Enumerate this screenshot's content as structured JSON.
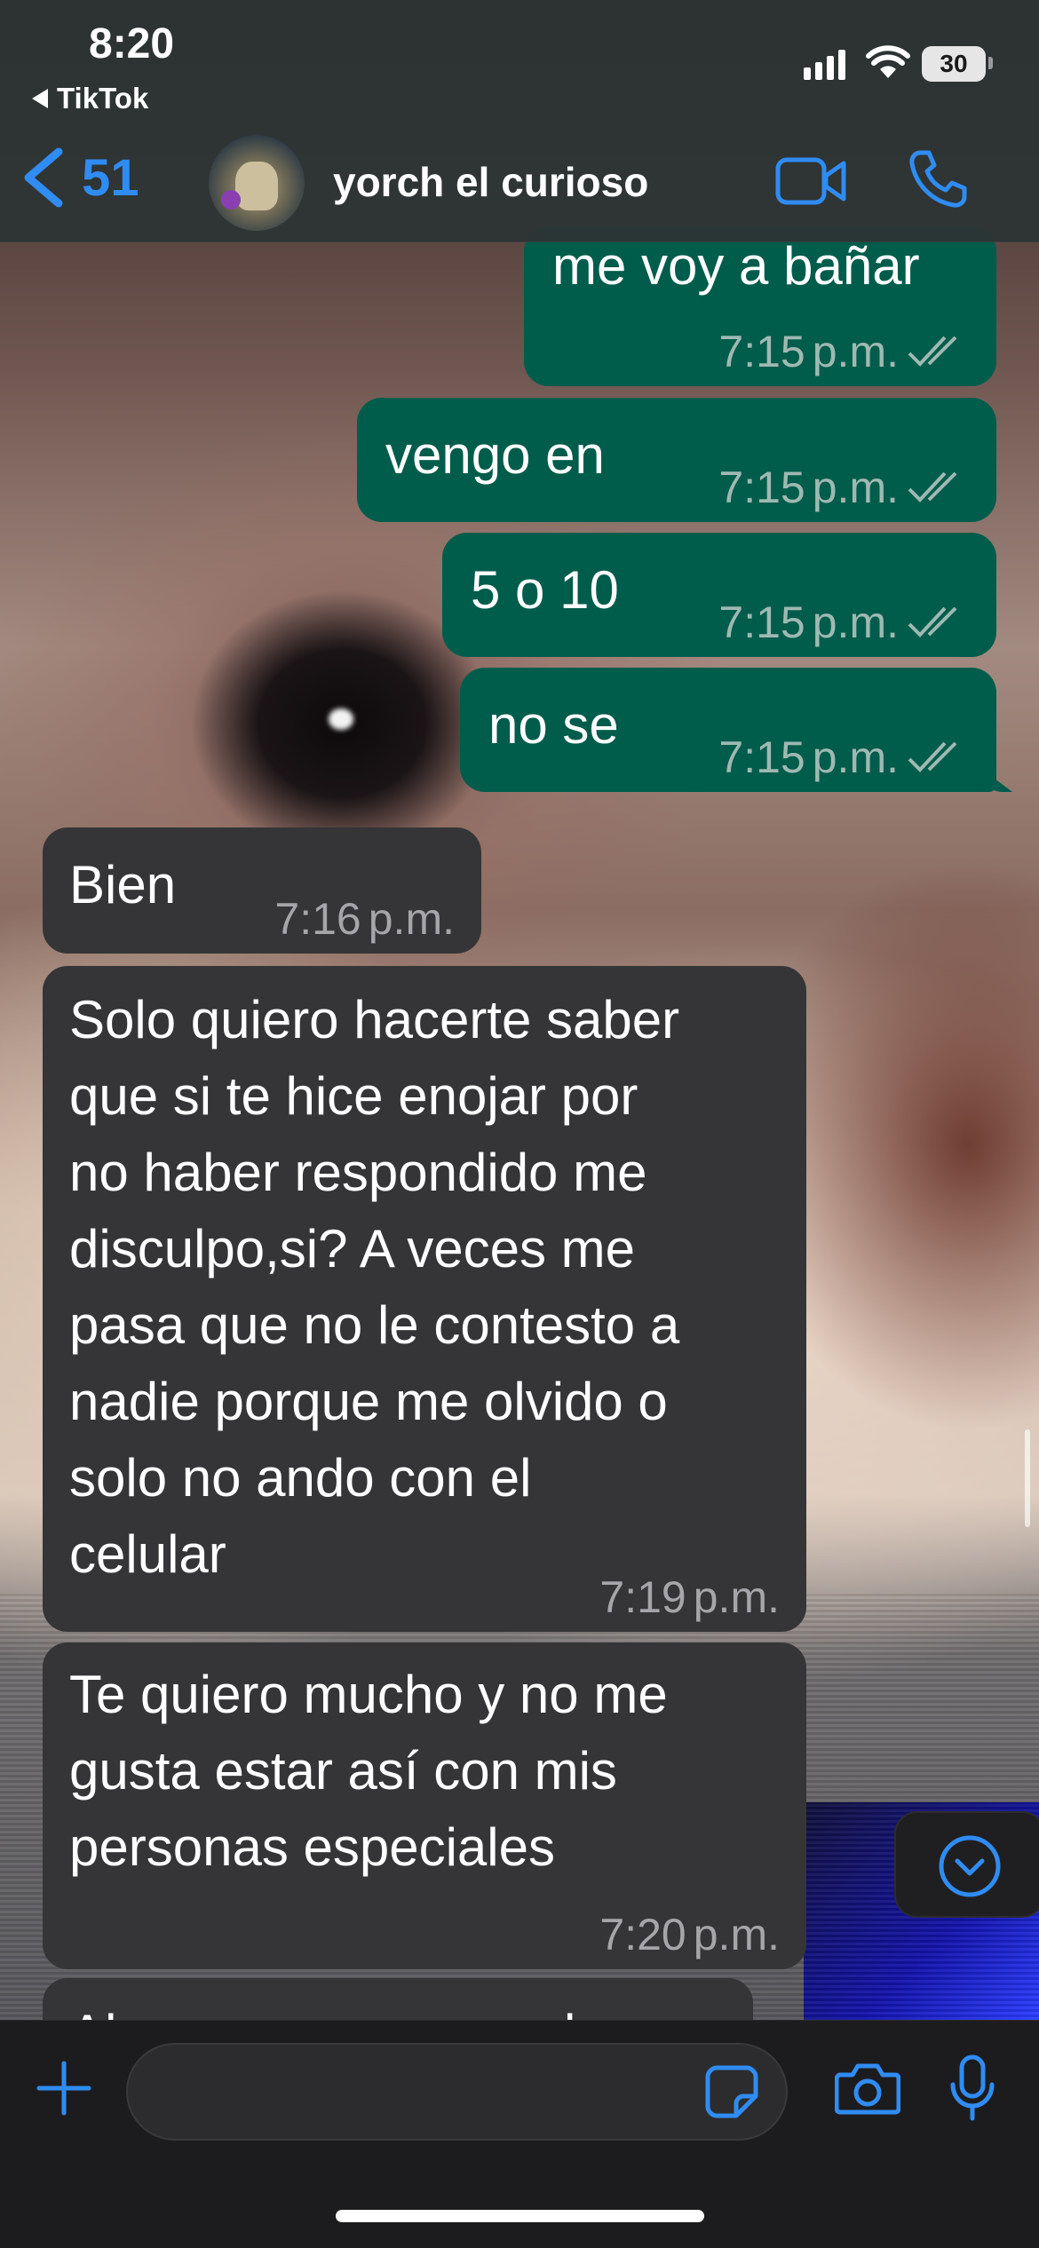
{
  "status_bar": {
    "time": "8:20",
    "back_app": "TikTok",
    "battery": "30"
  },
  "header": {
    "back_count": "51",
    "contact_name": "yorch el curioso"
  },
  "messages": [
    {
      "text": "me voy a bañar",
      "time": "7:15",
      "ampm": "p.m.",
      "direction": "outgoing",
      "status": "read"
    },
    {
      "text": "vengo en",
      "time": "7:15",
      "ampm": "p.m.",
      "direction": "outgoing",
      "status": "read"
    },
    {
      "text": "5 o 10",
      "time": "7:15",
      "ampm": "p.m.",
      "direction": "outgoing",
      "status": "read"
    },
    {
      "text": "no se",
      "time": "7:15",
      "ampm": "p.m.",
      "direction": "outgoing",
      "status": "read"
    },
    {
      "text": "Bien",
      "time": "7:16",
      "ampm": "p.m.",
      "direction": "incoming"
    },
    {
      "text": "Solo quiero hacerte saber\nque si te hice enojar por\nno haber respondido me\ndisculpo,si? A veces me\npasa que no le contesto a\nnadie porque me olvido o\nsolo no ando con el\ncelular",
      "time": "7:19",
      "ampm": "p.m.",
      "direction": "incoming"
    },
    {
      "text": "Te quiero mucho y no me\ngusta estar así con mis\npersonas especiales",
      "time": "7:20",
      "ampm": "p.m.",
      "direction": "incoming"
    },
    {
      "text": "Ahora voy a cargar el",
      "direction": "incoming",
      "partial": true
    }
  ],
  "composer": {
    "value": "",
    "placeholder": ""
  },
  "colors": {
    "accent": "#2f8cf2",
    "outgoing_bubble": "#005c4b",
    "incoming_bubble": "#353537"
  },
  "icons": [
    "back-chevron-icon",
    "video-call-icon",
    "phone-icon",
    "chevron-down-icon",
    "plus-icon",
    "sticker-icon",
    "camera-icon",
    "microphone-icon"
  ]
}
